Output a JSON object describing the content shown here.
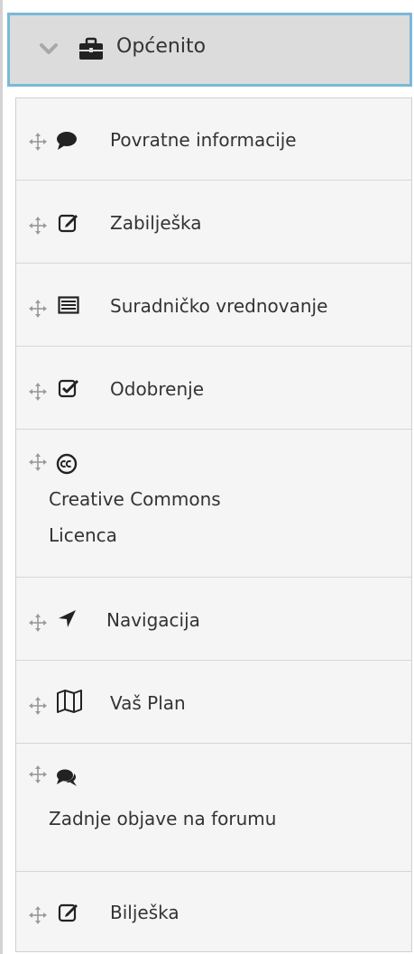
{
  "header": {
    "title": "Općenito",
    "chevron_icon": "chevron-down-icon",
    "section_icon": "briefcase-icon"
  },
  "colors": {
    "header_bg": "#dcdcdc",
    "header_border": "#7ab8d8",
    "item_bg": "#f5f5f5",
    "text": "#333333",
    "icon": "#222222",
    "move_icon": "#9a9a9a"
  },
  "blocks": [
    {
      "label": "Povratne informacije",
      "icon": "comment-icon"
    },
    {
      "label": "Zabilješka",
      "icon": "edit-icon"
    },
    {
      "label": "Suradničko vrednovanje",
      "icon": "list-alt-icon"
    },
    {
      "label": "Odobrenje",
      "icon": "check-square-icon"
    },
    {
      "label_line1": "Creative Commons",
      "label_line2": "Licenca",
      "icon": "creative-commons-icon"
    },
    {
      "label": "Navigacija",
      "icon": "location-arrow-icon"
    },
    {
      "label": "Vaš Plan",
      "icon": "map-icon"
    },
    {
      "label": "Zadnje objave na forumu",
      "icon": "comments-icon"
    },
    {
      "label": "Bilješka",
      "icon": "edit-icon"
    }
  ]
}
